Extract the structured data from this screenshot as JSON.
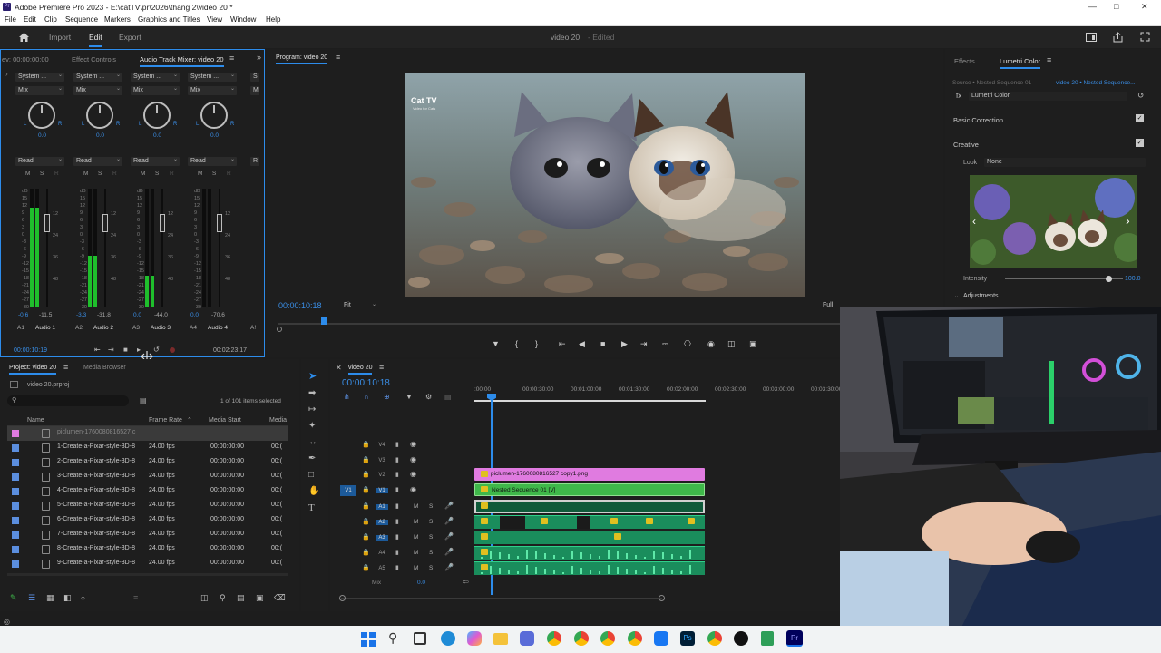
{
  "window": {
    "title": "Adobe Premiere Pro 2023 - E:\\catTV\\pr\\2026\\thang 2\\video 20 *",
    "app_badge": "Pr"
  },
  "menu": [
    "File",
    "Edit",
    "Clip",
    "Sequence",
    "Markers",
    "Graphics and Titles",
    "View",
    "Window",
    "Help"
  ],
  "workspace": {
    "tabs": [
      "Import",
      "Edit",
      "Export"
    ],
    "active": "Edit",
    "project_name": "video 20",
    "status": "- Edited"
  },
  "left_panel": {
    "tabs": [
      "ev: 00:00:00:00",
      "Effect Controls",
      "Audio Track Mixer: video 20"
    ],
    "channels": [
      {
        "output": "System ...",
        "mode": "Mix",
        "pan": "0.0",
        "auto": "Read",
        "peak": "-0.6",
        "vol": "-11.5",
        "id": "A1",
        "name": "Audio 1",
        "level": 0.84
      },
      {
        "output": "System ...",
        "mode": "Mix",
        "pan": "0.0",
        "auto": "Read",
        "peak": "-3.3",
        "vol": "-31.8",
        "id": "A2",
        "name": "Audio 2",
        "level": 0.43
      },
      {
        "output": "System ...",
        "mode": "Mix",
        "pan": "0.0",
        "auto": "Read",
        "peak": "0.0",
        "vol": "-44.0",
        "id": "A3",
        "name": "Audio 3",
        "level": 0.26
      },
      {
        "output": "System ...",
        "mode": "Mix",
        "pan": "0.0",
        "auto": "Read",
        "peak": "0.0",
        "vol": "-70.6",
        "id": "A4",
        "name": "Audio 4",
        "level": 0.0
      }
    ],
    "meter_scale": [
      "dB",
      "15",
      "12",
      "9",
      "6",
      "3",
      "0",
      "-3",
      "-6",
      "-9",
      "-12",
      "-15",
      "-18",
      "-21",
      "-24",
      "-27",
      "-30"
    ],
    "right_scale": [
      "12",
      "24",
      "36",
      "48"
    ],
    "partial_output": "S",
    "partial_mode": "M",
    "partial_auto": "R",
    "partial_id": "A!",
    "msr": [
      "M",
      "S",
      "R"
    ],
    "pan_lr": [
      "L",
      "R"
    ],
    "timecode_left": "00:00:10:19",
    "timecode_right": "00:02:23:17"
  },
  "program": {
    "tab": "Program: video 20",
    "timecode": "00:00:10:18",
    "fit": "Fit",
    "quality": "Full",
    "duration": "00:02:23:17",
    "watermark_line1": "Cat TV",
    "watermark_line2": "Video for Cats"
  },
  "project": {
    "tabs": [
      "Project: video 20",
      "Media Browser"
    ],
    "file": "video 20.prproj",
    "selection": "1 of 101 items selected",
    "columns": [
      "Name",
      "Frame Rate",
      "Media Start",
      "Media"
    ],
    "rows": [
      {
        "name": "piclumen-1760080816527 c",
        "fr": "",
        "ms": "",
        "md": "",
        "color": "#e07be0"
      },
      {
        "name": "1-Create-a-Pixar-style-3D-8",
        "fr": "24.00 fps",
        "ms": "00:00:00:00",
        "md": "00:(",
        "color": "#5b8ede"
      },
      {
        "name": "2-Create-a-Pixar-style-3D-8",
        "fr": "24.00 fps",
        "ms": "00:00:00:00",
        "md": "00:(",
        "color": "#5b8ede"
      },
      {
        "name": "3-Create-a-Pixar-style-3D-8",
        "fr": "24.00 fps",
        "ms": "00:00:00:00",
        "md": "00:(",
        "color": "#5b8ede"
      },
      {
        "name": "4-Create-a-Pixar-style-3D-8",
        "fr": "24.00 fps",
        "ms": "00:00:00:00",
        "md": "00:(",
        "color": "#5b8ede"
      },
      {
        "name": "5-Create-a-Pixar-style-3D-8",
        "fr": "24.00 fps",
        "ms": "00:00:00:00",
        "md": "00:(",
        "color": "#5b8ede"
      },
      {
        "name": "6-Create-a-Pixar-style-3D-8",
        "fr": "24.00 fps",
        "ms": "00:00:00:00",
        "md": "00:(",
        "color": "#5b8ede"
      },
      {
        "name": "7-Create-a-Pixar-style-3D-8",
        "fr": "24.00 fps",
        "ms": "00:00:00:00",
        "md": "00:(",
        "color": "#5b8ede"
      },
      {
        "name": "8-Create-a-Pixar-style-3D-8",
        "fr": "24.00 fps",
        "ms": "00:00:00:00",
        "md": "00:(",
        "color": "#5b8ede"
      },
      {
        "name": "9-Create-a-Pixar-style-3D-8",
        "fr": "24.00 fps",
        "ms": "00:00:00:00",
        "md": "00:(",
        "color": "#5b8ede"
      }
    ]
  },
  "timeline": {
    "tab": "video 20",
    "timecode": "00:00:10:18",
    "ruler": [
      ":00:00",
      "00:00:30:00",
      "00:01:00:00",
      "00:01:30:00",
      "00:02:00:00",
      "00:02:30:00",
      "00:03:00:00",
      "00:03:30:00"
    ],
    "video_tracks": [
      "V4",
      "V3",
      "V2",
      "V1"
    ],
    "audio_tracks": [
      "A1",
      "A2",
      "A3",
      "A4",
      "A5"
    ],
    "source_patch": "V1",
    "mix_label": "Mix",
    "mix_value": "0.0",
    "track_msr": [
      "M",
      "S"
    ],
    "clip_v2": "piclumen-1760080816527 copy1.png",
    "clip_v1": "Nested Sequence 01 [V]"
  },
  "lumetri": {
    "tabs": [
      "Effects",
      "Lumetri Color"
    ],
    "source": "Source • Nested Sequence 01",
    "target": "video 20 • Nested Sequence...",
    "effect": "Lumetri Color",
    "basic": "Basic Correction",
    "creative": "Creative",
    "look_label": "Look",
    "look_value": "None",
    "intensity_label": "Intensity",
    "intensity_value": "100.0",
    "intensity": 1.0,
    "adjustments": "Adjustments"
  },
  "colors": {
    "accent": "#2d8ceb",
    "audio_clip": "#1a8d5c",
    "video_clip": "#3fb84a",
    "graphic_clip": "#e07be0",
    "meter": "#1fbf2c"
  }
}
